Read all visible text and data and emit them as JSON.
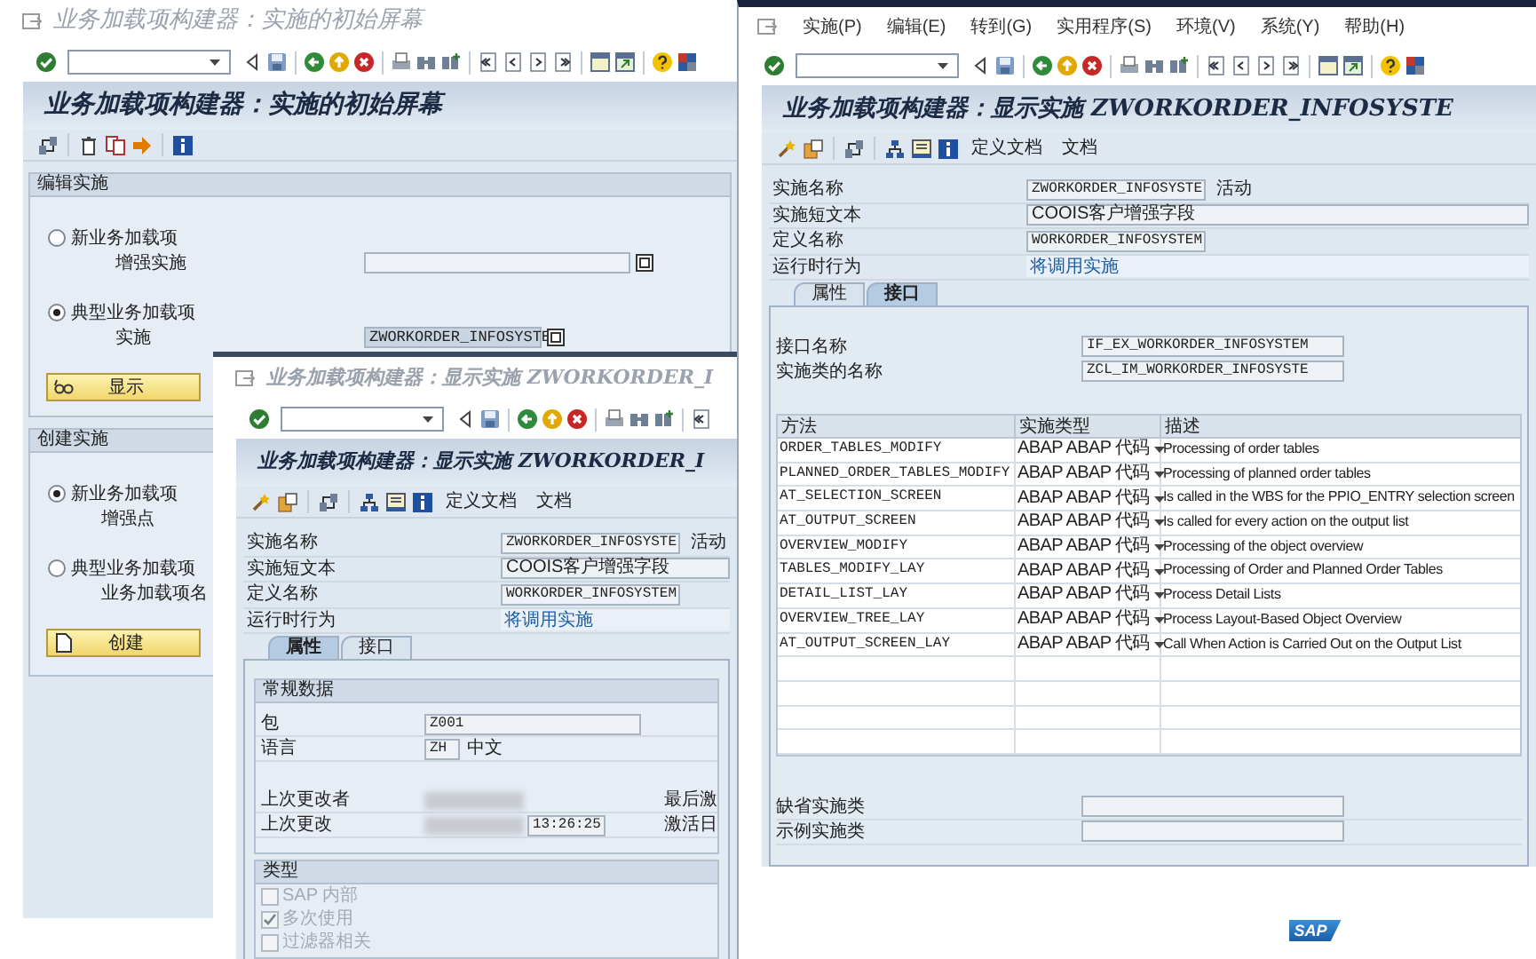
{
  "initial_window": {
    "title_bar": "业务加载项构建器：实施的初始屏幕",
    "screen_title": "业务加载项构建器：实施的初始屏幕",
    "groups": [
      {
        "title": "编辑实施",
        "options": [
          {
            "label": "新业务加载项",
            "selected": false,
            "field_label": "增强实施",
            "field_shown": true
          },
          {
            "label": "典型业务加载项",
            "selected": true,
            "field_label": "实施",
            "field_shown": true,
            "value": "ZWORKORDER_INFOSYSTE"
          }
        ],
        "button": "显示"
      },
      {
        "title": "创建实施",
        "options": [
          {
            "label": "新业务加载项",
            "selected": true,
            "field_label": "增强点"
          },
          {
            "label": "典型业务加载项",
            "selected": false,
            "field_label": "业务加载项名"
          }
        ],
        "button": "创建"
      }
    ]
  },
  "display_window_back": {
    "title_bar": "业务加载项构建器：显示实施 ZWORKORDER_I",
    "screen_title": "业务加载项构建器：显示实施 ZWORKORDER_I",
    "toolbar_buttons": [
      "定义文档",
      "文档"
    ],
    "header_fields": [
      {
        "label": "实施名称",
        "kind": "field",
        "value": "ZWORKORDER_INFOSYSTE",
        "status": "活动"
      },
      {
        "label": "实施短文本",
        "kind": "wide_field",
        "value": "COOIS客户增强字段"
      },
      {
        "label": "定义名称",
        "kind": "field",
        "value": "WORKORDER_INFOSYSTEM"
      },
      {
        "label": "运行时行为",
        "kind": "link",
        "value": "将调用实施"
      }
    ],
    "tabs": [
      {
        "label": "属性",
        "selected": true
      },
      {
        "label": "接口",
        "selected": false
      }
    ],
    "general_data": {
      "title": "常规数据",
      "rows": [
        {
          "label": "包",
          "value": "Z001"
        },
        {
          "label": "语言",
          "value": "ZH",
          "value_text": "中文"
        },
        {
          "label": "上次更改者",
          "redacted": true,
          "side_label": "最后激"
        },
        {
          "label": "上次更改",
          "redacted": true,
          "value": "13:26:25",
          "side_label": "激活日"
        }
      ]
    },
    "type_group": {
      "title": "类型",
      "checkboxes": [
        {
          "label": "SAP 内部",
          "checked": false,
          "disabled": true
        },
        {
          "label": "多次使用",
          "checked": true,
          "disabled": true
        },
        {
          "label": "过滤器相关",
          "checked": false,
          "disabled": true
        }
      ]
    }
  },
  "display_window_front": {
    "menu": [
      "实施(P)",
      "编辑(E)",
      "转到(G)",
      "实用程序(S)",
      "环境(V)",
      "系统(Y)",
      "帮助(H)"
    ],
    "screen_title": "业务加载项构建器：显示实施 ZWORKORDER_INFOSYSTE",
    "toolbar_buttons": [
      "定义文档",
      "文档"
    ],
    "header_fields": [
      {
        "label": "实施名称",
        "kind": "field",
        "value": "ZWORKORDER_INFOSYSTE",
        "status": "活动"
      },
      {
        "label": "实施短文本",
        "kind": "wide_field",
        "value": "COOIS客户增强字段"
      },
      {
        "label": "定义名称",
        "kind": "field",
        "value": "WORKORDER_INFOSYSTEM"
      },
      {
        "label": "运行时行为",
        "kind": "link",
        "value": "将调用实施"
      }
    ],
    "tabs": [
      {
        "label": "属性",
        "selected": false
      },
      {
        "label": "接口",
        "selected": true
      }
    ],
    "interface_fields": [
      {
        "label": "接口名称",
        "value": "IF_EX_WORKORDER_INFOSYSTEM"
      },
      {
        "label": "实施类的名称",
        "value": "ZCL_IM_WORKORDER_INFOSYSTE"
      }
    ],
    "methods_table": {
      "columns": [
        "方法",
        "实施类型",
        "描述"
      ],
      "rows": [
        {
          "method": "ORDER_TABLES_MODIFY",
          "impl_type": "ABAP ABAP 代码",
          "description": "Processing of order tables"
        },
        {
          "method": "PLANNED_ORDER_TABLES_MODIFY",
          "impl_type": "ABAP ABAP 代码",
          "description": "Processing of planned order tables"
        },
        {
          "method": "AT_SELECTION_SCREEN",
          "impl_type": "ABAP ABAP 代码",
          "description": "Is called in the WBS for the PPIO_ENTRY selection screen"
        },
        {
          "method": "AT_OUTPUT_SCREEN",
          "impl_type": "ABAP ABAP 代码",
          "description": "Is called for every action on the output list"
        },
        {
          "method": "OVERVIEW_MODIFY",
          "impl_type": "ABAP ABAP 代码",
          "description": "Processing of the object overview"
        },
        {
          "method": "TABLES_MODIFY_LAY",
          "impl_type": "ABAP ABAP 代码",
          "description": "Processing of Order and Planned Order Tables"
        },
        {
          "method": "DETAIL_LIST_LAY",
          "impl_type": "ABAP ABAP 代码",
          "description": "Process Detail Lists"
        },
        {
          "method": "OVERVIEW_TREE_LAY",
          "impl_type": "ABAP ABAP 代码",
          "description": "Process Layout-Based Object Overview"
        },
        {
          "method": "AT_OUTPUT_SCREEN_LAY",
          "impl_type": "ABAP ABAP 代码",
          "description": "Call When Action is Carried Out on the Output List"
        }
      ]
    },
    "class_fields": [
      {
        "label": "缺省实施类"
      },
      {
        "label": "示例实施类"
      }
    ],
    "logo": "SAP"
  }
}
